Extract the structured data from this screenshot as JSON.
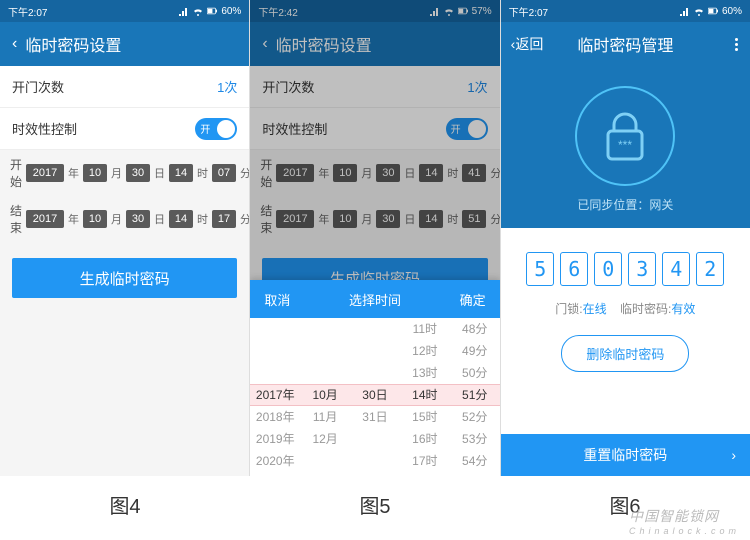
{
  "status": {
    "time4": "下午2:07",
    "time5": "下午2:42",
    "time6": "下午2:07",
    "batt4": "60%",
    "batt5": "57%",
    "batt6": "60%"
  },
  "hdr": {
    "settings": "临时密码设置",
    "back": "返回",
    "manage": "临时密码管理",
    "backArrow": "‹",
    "dots": "⋮"
  },
  "rows": {
    "openCount": "开门次数",
    "openCountVal": "1次",
    "timeCtrl": "时效性控制",
    "toggleOn": "开"
  },
  "dates4": {
    "startLbl": "开始",
    "endLbl": "结束",
    "year": "2017",
    "mon": "10",
    "day": "30",
    "hr": "14",
    "smin": "07",
    "emin": "17",
    "yu": "年",
    "mu": "月",
    "du": "日",
    "hu": "时",
    "fu": "分"
  },
  "dates5": {
    "smin": "41",
    "emin": "51"
  },
  "gen": "生成临时密码",
  "picker": {
    "cancel": "取消",
    "title": "选择时间",
    "confirm": "确定",
    "years": [
      "",
      "",
      "",
      "2017年",
      "2018年",
      "2019年",
      "2020年"
    ],
    "months": [
      "",
      "",
      "",
      "10月",
      "11月",
      "12月",
      ""
    ],
    "days": [
      "",
      "",
      "",
      "30日",
      "31日",
      "",
      ""
    ],
    "hours": [
      "11时",
      "12时",
      "13时",
      "14时",
      "15时",
      "16时",
      "17时"
    ],
    "mins": [
      "48分",
      "49分",
      "50分",
      "51分",
      "52分",
      "53分",
      "54分"
    ]
  },
  "s3": {
    "sync": "已同步位置：网关",
    "code": [
      "5",
      "6",
      "0",
      "3",
      "4",
      "2"
    ],
    "lockLbl": "门锁:",
    "lockOn": "在线",
    "pwdLbl": "临时密码:",
    "pwdOn": "有效",
    "delete": "删除临时密码",
    "reset": "重置临时密码",
    "chev": "›",
    "stars": "***"
  },
  "caps": {
    "c4": "图4",
    "c5": "图5",
    "c6": "图6"
  },
  "wm": {
    "a": "中国智能锁网",
    "b": "Chinalock.com"
  }
}
